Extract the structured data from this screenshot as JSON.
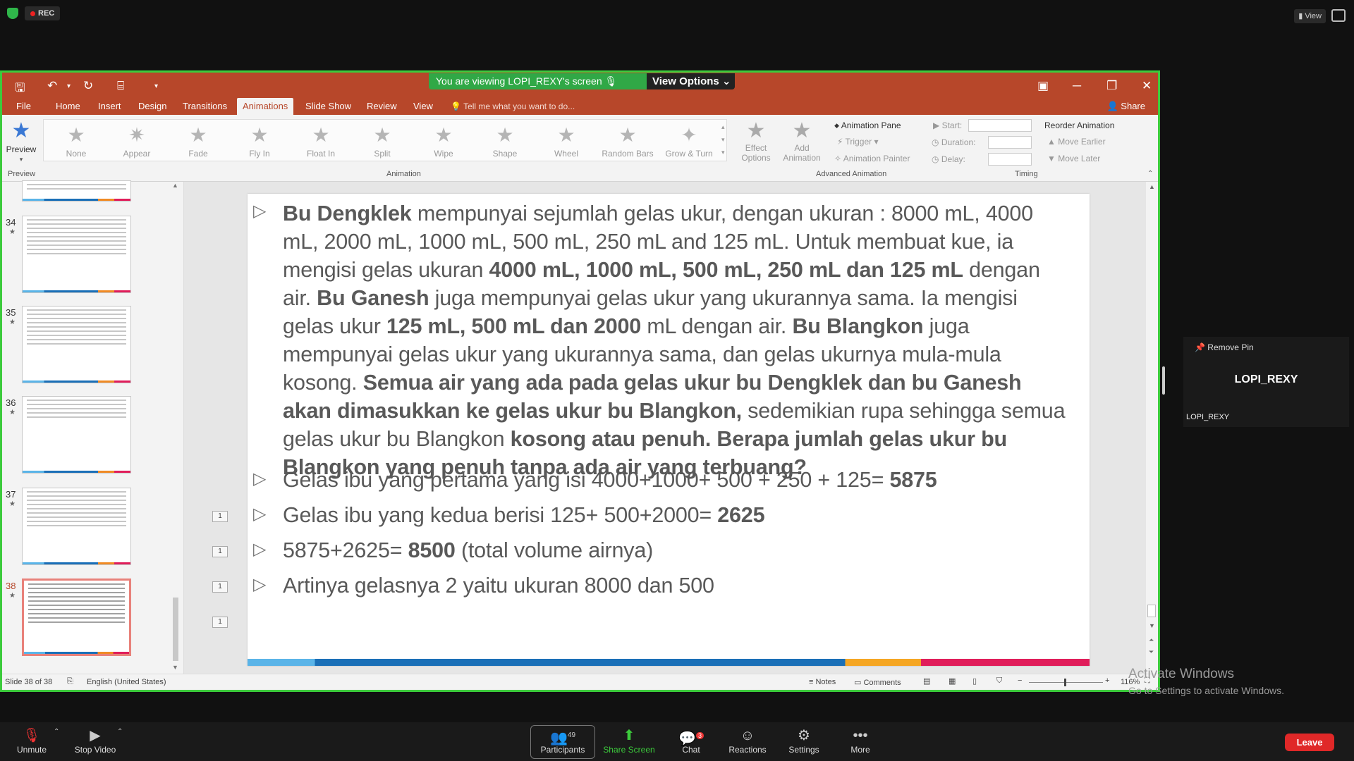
{
  "top": {
    "rec": "REC",
    "view": "View"
  },
  "banner": {
    "text": "You are viewing LOPI_REXY's screen",
    "view_options": "View Options"
  },
  "tabs": [
    "File",
    "Home",
    "Insert",
    "Design",
    "Transitions",
    "Animations",
    "Slide Show",
    "Review",
    "View"
  ],
  "tell_me": "Tell me what you want to do...",
  "share": "Share",
  "preview": {
    "label": "Preview",
    "group": "Preview"
  },
  "animations": [
    "None",
    "Appear",
    "Fade",
    "Fly In",
    "Float In",
    "Split",
    "Wipe",
    "Shape",
    "Wheel",
    "Random Bars",
    "Grow & Turn"
  ],
  "animation_group": "Animation",
  "effect_options": [
    "Effect",
    "Options"
  ],
  "add_animation": [
    "Add",
    "Animation"
  ],
  "advanced": {
    "pane": "Animation Pane",
    "trigger": "Trigger",
    "painter": "Animation Painter",
    "group": "Advanced Animation"
  },
  "timing": {
    "start": "Start:",
    "duration": "Duration:",
    "delay": "Delay:",
    "reorder": "Reorder Animation",
    "earlier": "Move Earlier",
    "later": "Move Later",
    "group": "Timing"
  },
  "thumbs": [
    "34",
    "35",
    "36",
    "37",
    "38"
  ],
  "slide": {
    "p1": [
      {
        "t": "Bu Dengklek",
        "b": true
      },
      {
        "t": " mempunyai sejumlah gelas ukur, dengan ukuran : 8000 mL, 4000 mL, 2000 mL, 1000 mL, 500 mL, 250 mL and 125 mL. Untuk membuat kue, ia mengisi gelas ukuran ",
        "b": false
      },
      {
        "t": "4000 mL, 1000 mL, 500 mL, 250 mL dan 125 mL",
        "b": true
      },
      {
        "t": " dengan air. ",
        "b": false
      },
      {
        "t": "Bu Ganesh",
        "b": true
      },
      {
        "t": " juga mempunyai gelas ukur yang ukurannya sama. Ia mengisi gelas ukur ",
        "b": false
      },
      {
        "t": "125 mL, 500 mL dan 2000",
        "b": true
      },
      {
        "t": " mL dengan air. ",
        "b": false
      },
      {
        "t": "Bu Blangkon",
        "b": true
      },
      {
        "t": " juga mempunyai gelas ukur yang ukurannya sama, dan gelas ukurnya mula-mula kosong. ",
        "b": false
      },
      {
        "t": "Semua air yang ada pada gelas ukur bu Dengklek dan bu Ganesh akan dimasukkan ke gelas ukur bu Blangkon,",
        "b": true
      },
      {
        "t": " sedemikian rupa sehingga semua gelas ukur bu Blangkon ",
        "b": false
      },
      {
        "t": "kosong atau penuh. Berapa jumlah gelas ukur bu Blangkon yang penuh tanpa ada air yang terbuang?",
        "b": true
      }
    ],
    "b1a": "Gelas ibu yang pertama yang isi   4000+1000+ 500 + 250 + 125= ",
    "b1b": "5875",
    "b2a": "Gelas ibu yang kedua berisi 125+ 500+2000= ",
    "b2b": "2625",
    "b3a": "5875+2625= ",
    "b3b": "8500",
    "b3c": " (total volume airnya)",
    "b4": "Artinya gelasnya 2 yaitu ukuran 8000 dan 500",
    "tags": [
      "1",
      "1",
      "1",
      "1"
    ]
  },
  "status": {
    "slide": "Slide 38 of 38",
    "lang": "English (United States)",
    "notes": "Notes",
    "comments": "Comments",
    "zoom": "116%"
  },
  "pin": {
    "remove": "Remove Pin",
    "name": "LOPI_REXY",
    "label": "LOPI_REXY"
  },
  "activate": {
    "title": "Activate Windows",
    "sub": "Go to Settings to activate Windows."
  },
  "bottom": {
    "unmute": "Unmute",
    "video": "Stop Video",
    "participants": "Participants",
    "participants_count": "49",
    "share": "Share Screen",
    "chat": "Chat",
    "chat_badge": "3",
    "reactions": "Reactions",
    "settings": "Settings",
    "more": "More",
    "leave": "Leave"
  }
}
